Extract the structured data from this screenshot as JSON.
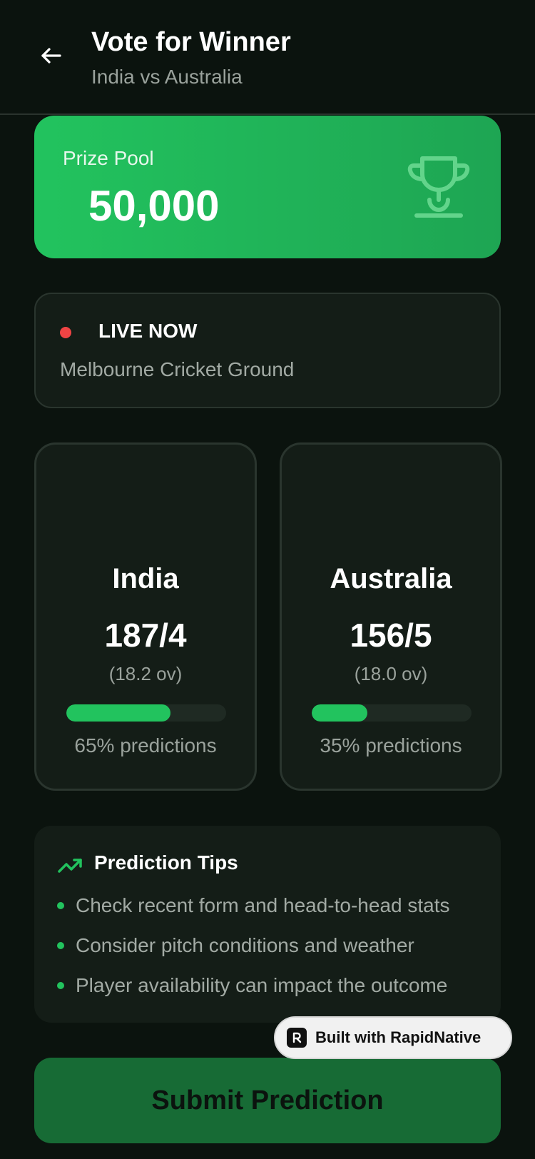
{
  "header": {
    "title": "Vote for Winner",
    "subtitle": "India vs Australia"
  },
  "prize": {
    "label": "Prize Pool",
    "value": "50,000",
    "icon": "trophy-icon"
  },
  "live": {
    "status": "LIVE NOW",
    "venue": "Melbourne Cricket Ground",
    "dot_color": "#ef4444"
  },
  "teams": [
    {
      "name": "India",
      "score": "187/4",
      "overs": "(18.2 ov)",
      "prediction_percent": 65,
      "prediction_label": "65% predictions"
    },
    {
      "name": "Australia",
      "score": "156/5",
      "overs": "(18.0 ov)",
      "prediction_percent": 35,
      "prediction_label": "35% predictions"
    }
  ],
  "tips": {
    "title": "Prediction Tips",
    "icon": "trending-up-icon",
    "items": [
      "Check recent form and head-to-head stats",
      "Consider pitch conditions and weather",
      "Player availability can impact the outcome"
    ]
  },
  "badge": {
    "label": "Built with RapidNative"
  },
  "submit": {
    "label": "Submit Prediction"
  },
  "colors": {
    "accent": "#22c35e",
    "background": "#0b130e",
    "card": "#141d17",
    "submit": "#176b35"
  }
}
